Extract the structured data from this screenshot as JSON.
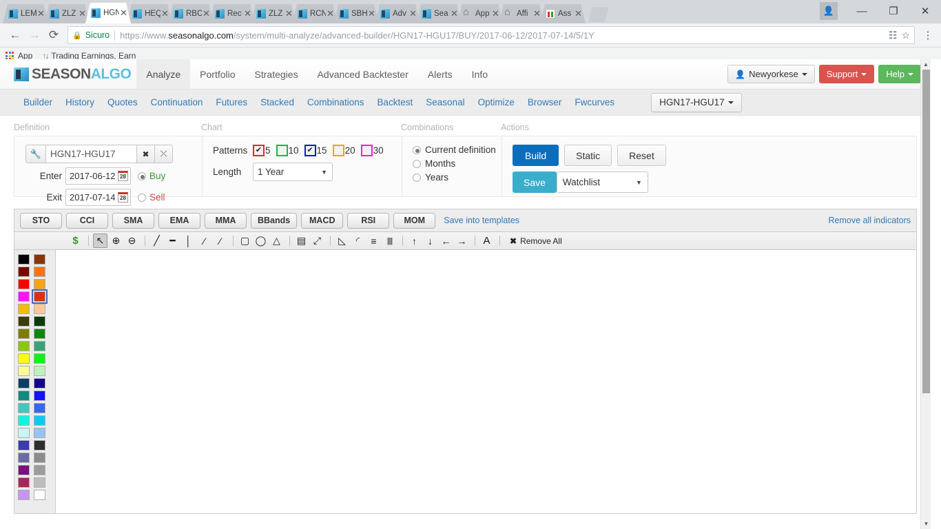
{
  "browser": {
    "tabs": [
      {
        "label": "LEM",
        "icon": "seasonalgo-favicon",
        "active": false
      },
      {
        "label": "ZLZ",
        "icon": "seasonalgo-favicon",
        "active": false
      },
      {
        "label": "HGN",
        "icon": "seasonalgo-favicon",
        "active": true
      },
      {
        "label": "HEQ",
        "icon": "seasonalgo-favicon",
        "active": false
      },
      {
        "label": "RBC",
        "icon": "seasonalgo-favicon",
        "active": false
      },
      {
        "label": "Rec",
        "icon": "seasonalgo-favicon",
        "active": false
      },
      {
        "label": "ZLZ",
        "icon": "seasonalgo-favicon",
        "active": false
      },
      {
        "label": "RCN",
        "icon": "seasonalgo-favicon",
        "active": false
      },
      {
        "label": "SBH",
        "icon": "seasonalgo-favicon",
        "active": false
      },
      {
        "label": "Adv",
        "icon": "seasonalgo-favicon",
        "active": false
      },
      {
        "label": "Sea",
        "icon": "seasonalgo-favicon",
        "active": false
      },
      {
        "label": "App",
        "icon": "home-favicon",
        "active": false
      },
      {
        "label": "Affi",
        "icon": "home-favicon",
        "active": false
      },
      {
        "label": "Ass",
        "icon": "chart-favicon",
        "active": false
      }
    ],
    "tab_close_label": "✕",
    "window_controls": {
      "minimize": "—",
      "maximize": "❐",
      "close": "✕",
      "profile": "person-icon"
    },
    "nav": {
      "back": "←",
      "forward": "→",
      "reload": "⟳"
    },
    "omnibox": {
      "secure_label": "Sicuro",
      "url_scheme": "https://www.",
      "url_host": "seasonalgo.com",
      "url_path": "/system/multi-analyze/advanced-builder/HGN17-HGU17/BUY/2017-06-12/2017-07-14/5/1Y",
      "translate_icon": "translate-icon",
      "bookmark_icon": "star-icon",
      "menu_icon": "three-dots-icon"
    },
    "bookmarks": [
      {
        "label": "App",
        "icon": "apps-grid-icon"
      },
      {
        "label": "Trading Earnings, Earn",
        "icon": "up-down-arrows-icon"
      }
    ]
  },
  "app": {
    "logo": {
      "part1": "SEASON",
      "part2": "ALGO"
    },
    "nav": [
      {
        "label": "Analyze",
        "active": true
      },
      {
        "label": "Portfolio",
        "active": false
      },
      {
        "label": "Strategies",
        "active": false
      },
      {
        "label": "Advanced Backtester",
        "active": false
      },
      {
        "label": "Alerts",
        "active": false
      },
      {
        "label": "Info",
        "active": false
      }
    ],
    "user": {
      "name": "Newyorkese",
      "icon": "user-icon"
    },
    "support_label": "Support",
    "help_label": "Help",
    "subnav": [
      "Builder",
      "History",
      "Quotes",
      "Continuation",
      "Futures",
      "Stacked",
      "Combinations",
      "Backtest",
      "Seasonal",
      "Optimize",
      "Browser",
      "Fwcurves"
    ],
    "symbol_selector": "HGN17-HGU17"
  },
  "sections": {
    "definition_label": "Definition",
    "chart_label": "Chart",
    "combinations_label": "Combinations",
    "actions_label": "Actions"
  },
  "definition": {
    "wrench_icon": "wrench-icon",
    "symbol_value": "HGN17-HGU17",
    "clear_icon": "✖",
    "swap_icon": "⤫",
    "enter_label": "Enter",
    "enter_date": "2017-06-12",
    "exit_label": "Exit",
    "exit_date": "2017-07-14",
    "calendar_day": "28",
    "buy_label": "Buy",
    "sell_label": "Sell",
    "side_selected": "Buy"
  },
  "chart": {
    "patterns_label": "Patterns",
    "patterns": [
      {
        "value": "5",
        "checked": true,
        "color": "#e52b1f"
      },
      {
        "value": "10",
        "checked": false,
        "color": "#22b14c"
      },
      {
        "value": "15",
        "checked": true,
        "color": "#1019c8"
      },
      {
        "value": "20",
        "checked": false,
        "color": "#f0a318"
      },
      {
        "value": "30",
        "checked": false,
        "color": "#f020d0"
      }
    ],
    "length_label": "Length",
    "length_value": "1 Year"
  },
  "combinations": {
    "options": [
      {
        "label": "Current definition",
        "selected": true
      },
      {
        "label": "Months",
        "selected": false
      },
      {
        "label": "Years",
        "selected": false
      }
    ]
  },
  "actions": {
    "build_label": "Build",
    "static_label": "Static",
    "reset_label": "Reset",
    "save_label": "Save",
    "watchlist_value": "Watchlist"
  },
  "indicators": {
    "buttons": [
      "STO",
      "CCI",
      "SMA",
      "EMA",
      "MMA",
      "BBands",
      "MACD",
      "RSI",
      "MOM"
    ],
    "save_templates_label": "Save into templates",
    "remove_all_label": "Remove all indicators"
  },
  "drawtools": {
    "items": [
      {
        "name": "dollar-icon",
        "glyph": "$",
        "active": false,
        "color": "#3a9b35"
      },
      {
        "name": "separator-1",
        "glyph": "|",
        "sep": true
      },
      {
        "name": "cursor-icon",
        "glyph": "↖",
        "active": true
      },
      {
        "name": "zoom-in-icon",
        "glyph": "⊕",
        "active": false
      },
      {
        "name": "zoom-out-icon",
        "glyph": "⊖",
        "active": false
      },
      {
        "name": "separator-2",
        "glyph": "|",
        "sep": true
      },
      {
        "name": "trendline-icon",
        "glyph": "╱",
        "active": false
      },
      {
        "name": "horizontal-line-icon",
        "glyph": "━",
        "active": false
      },
      {
        "name": "vertical-line-icon",
        "glyph": "│",
        "active": false
      },
      {
        "name": "ray-icon",
        "glyph": "⁄",
        "active": false
      },
      {
        "name": "extended-line-icon",
        "glyph": "⁄",
        "active": false
      },
      {
        "name": "separator-3",
        "glyph": "|",
        "sep": true
      },
      {
        "name": "rectangle-icon",
        "glyph": "▢",
        "active": false
      },
      {
        "name": "ellipse-icon",
        "glyph": "◯",
        "active": false
      },
      {
        "name": "triangle-icon",
        "glyph": "△",
        "active": false
      },
      {
        "name": "separator-4",
        "glyph": "|",
        "sep": true
      },
      {
        "name": "filled-rectangle-icon",
        "glyph": "▤",
        "active": false
      },
      {
        "name": "parallel-channel-icon",
        "glyph": "⤢",
        "active": false
      },
      {
        "name": "separator-5",
        "glyph": "|",
        "sep": true
      },
      {
        "name": "gann-fan-icon",
        "glyph": "◺",
        "active": false
      },
      {
        "name": "fibonacci-arc-icon",
        "glyph": "◜",
        "active": false
      },
      {
        "name": "fibonacci-retracement-icon",
        "glyph": "≡",
        "active": false
      },
      {
        "name": "fibonacci-timezone-icon",
        "glyph": "||||",
        "active": false
      },
      {
        "name": "separator-6",
        "glyph": "|",
        "sep": true
      },
      {
        "name": "arrow-up-icon",
        "glyph": "↑",
        "active": false
      },
      {
        "name": "arrow-down-icon",
        "glyph": "↓",
        "active": false
      },
      {
        "name": "arrow-left-icon",
        "glyph": "←",
        "active": false
      },
      {
        "name": "arrow-right-icon",
        "glyph": "→",
        "active": false
      },
      {
        "name": "separator-7",
        "glyph": "|",
        "sep": true
      },
      {
        "name": "text-icon",
        "glyph": "A",
        "active": false
      },
      {
        "name": "separator-8",
        "glyph": "|",
        "sep": true
      }
    ],
    "remove_all_label": "Remove All",
    "remove_all_icon": "✖"
  },
  "palette": {
    "selected_index": 7,
    "colors": [
      "#000000",
      "#8c3409",
      "#7d0000",
      "#fa7415",
      "#fb0000",
      "#f5a318",
      "#f815f8",
      "#d5330f",
      "#f2bb09",
      "#fbc99b",
      "#3b3e06",
      "#0a3c0a",
      "#7d7d08",
      "#0f860f",
      "#8cc514",
      "#3aa173",
      "#fbfb15",
      "#12f112",
      "#fbfb9b",
      "#bdf2bd",
      "#0d3f66",
      "#13008c",
      "#128a80",
      "#1313f5",
      "#41c7bd",
      "#3866ef",
      "#10f5e0",
      "#12c7f2",
      "#c6f7f2",
      "#93c4f2",
      "#3b3bad",
      "#2e2e2e",
      "#6b6ba3",
      "#8c8c8c",
      "#7d0f7d",
      "#9c9c9c",
      "#a3285c",
      "#bdbdbd",
      "#c495f2",
      "#ffffff"
    ]
  }
}
